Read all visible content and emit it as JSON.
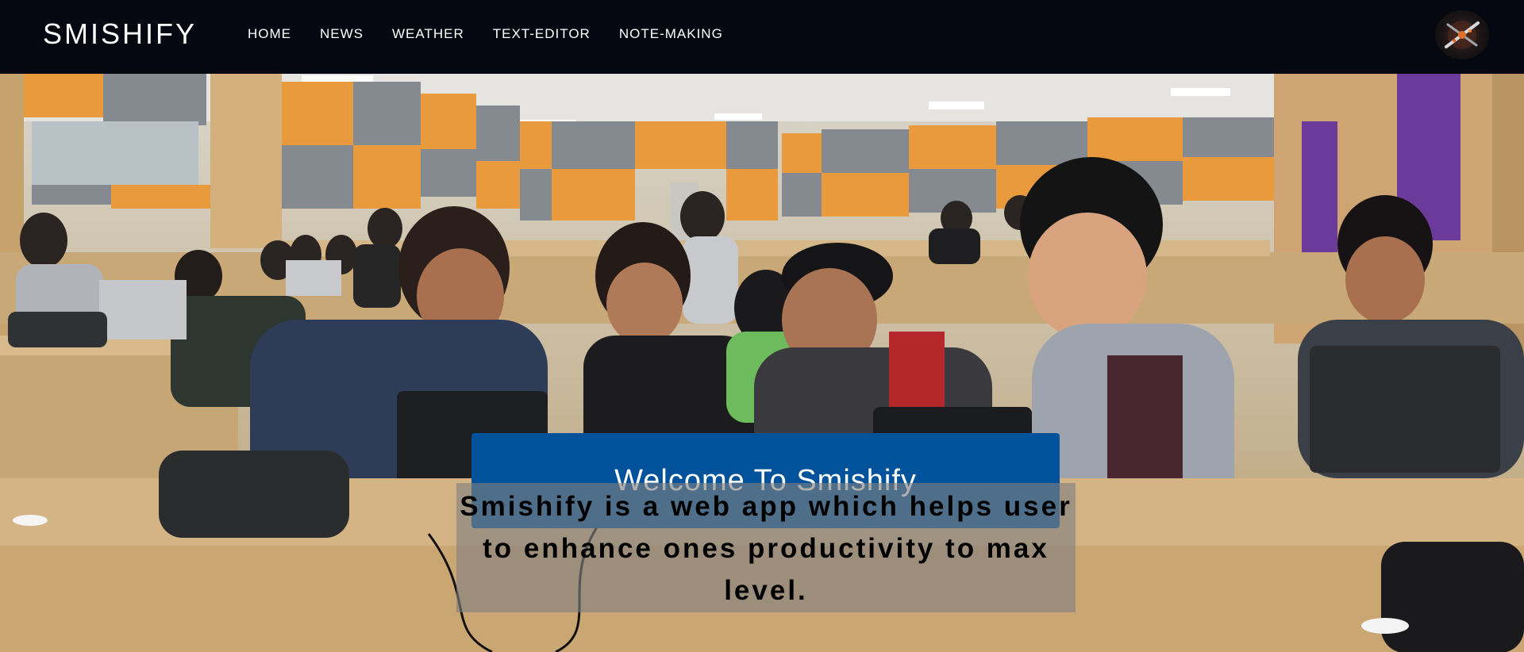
{
  "brand": {
    "name": "SMISHIFY"
  },
  "nav": {
    "items": [
      {
        "label": "HOME"
      },
      {
        "label": "NEWS"
      },
      {
        "label": "WEATHER"
      },
      {
        "label": "TEXT-EDITOR"
      },
      {
        "label": "NOTE-MAKING"
      }
    ]
  },
  "hero": {
    "welcome": "Welcome To Smishify",
    "tagline": "Smishify is a web app which helps user to enhance ones productivity to max level."
  },
  "colors": {
    "navbar_bg": "#050811",
    "banner_bg": "#00529b",
    "tagline_bg": "rgba(128,128,128,0.62)"
  }
}
